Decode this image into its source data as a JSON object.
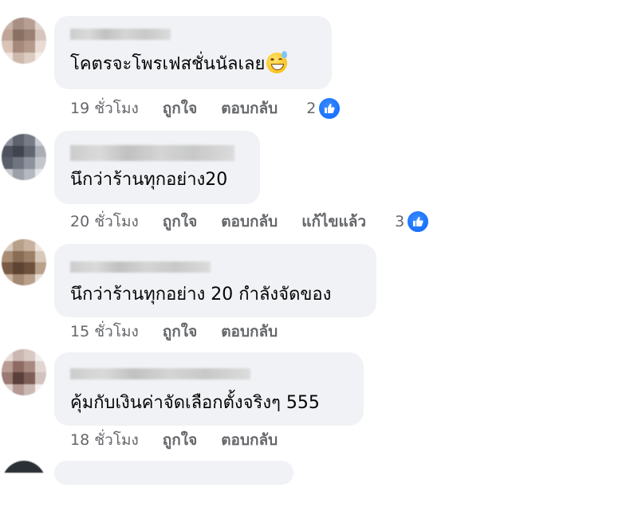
{
  "comments": [
    {
      "text": "โคตรจะโพรเฟสชั่นนัลเลย",
      "emoji": "grinning-face-with-sweat-icon",
      "time": "19 ชั่วโมง",
      "like_label": "ถูกใจ",
      "reply_label": "ตอบกลับ",
      "reaction_count": "2"
    },
    {
      "text": "นึกว่าร้านทุกอย่าง20",
      "time": "20 ชั่วโมง",
      "like_label": "ถูกใจ",
      "reply_label": "ตอบกลับ",
      "edited_label": "แก้ไขแล้ว",
      "reaction_count": "3"
    },
    {
      "text": "นึกว่าร้านทุกอย่าง 20 กำลังจัดของ",
      "time": "15 ชั่วโมง",
      "like_label": "ถูกใจ",
      "reply_label": "ตอบกลับ"
    },
    {
      "text": "คุ้มกับเงินค่าจัดเลือกตั้งจริงๆ 555",
      "time": "18 ชั่วโมง",
      "like_label": "ถูกใจ",
      "reply_label": "ตอบกลับ"
    }
  ],
  "colors": {
    "bubble": "#f0f2f5",
    "meta_text": "#65676b",
    "like_blue": "#0866ff"
  }
}
